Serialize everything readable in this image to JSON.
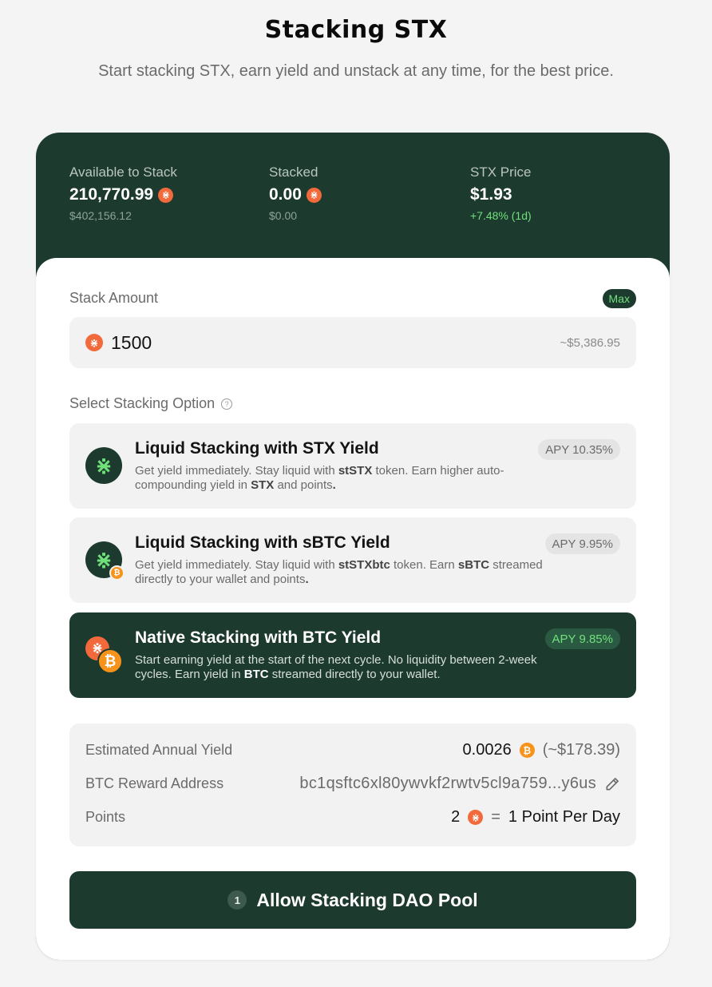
{
  "header": {
    "title": "Stacking STX",
    "subtitle": "Start stacking STX, earn yield and unstack at any time, for the best price."
  },
  "stats": {
    "available": {
      "label": "Available to Stack",
      "value": "210,770.99",
      "usd": "$402,156.12"
    },
    "stacked": {
      "label": "Stacked",
      "value": "0.00",
      "usd": "$0.00"
    },
    "price": {
      "label": "STX Price",
      "value": "$1.93",
      "change": "+7.48% (1d)"
    }
  },
  "form": {
    "amount_label": "Stack Amount",
    "max_label": "Max",
    "amount_value": "1500",
    "amount_usd": "~$5,386.95",
    "options_label": "Select Stacking Option"
  },
  "options": [
    {
      "title": "Liquid Stacking with STX Yield",
      "apy": "APY 10.35%",
      "desc": [
        "Get yield immediately. Stay liquid with ",
        "stSTX",
        " token. Earn higher auto-compounding yield in ",
        "STX",
        " and points",
        "."
      ],
      "selected": false
    },
    {
      "title": "Liquid Stacking with sBTC Yield",
      "apy": "APY 9.95%",
      "desc": [
        "Get yield immediately. Stay liquid with ",
        "stSTXbtc",
        " token. Earn ",
        "sBTC",
        " streamed directly to your wallet and points",
        "."
      ],
      "selected": false
    },
    {
      "title": "Native Stacking with BTC Yield",
      "apy": "APY 9.85%",
      "desc": [
        "Start earning yield at the start of the next cycle. No liquidity between 2-week cycles. Earn yield in ",
        "BTC",
        " streamed directly to your wallet."
      ],
      "selected": true
    }
  ],
  "summary": {
    "annual_yield_label": "Estimated Annual Yield",
    "annual_yield_value": "0.0026",
    "annual_yield_usd": "(~$178.39)",
    "address_label": "BTC Reward Address",
    "address_value": "bc1qsftc6xl80ywvkf2rwtv5cl9a759...y6us",
    "points_label": "Points",
    "points_value": "2",
    "points_equals": "=",
    "points_rate": "1 Point Per Day"
  },
  "cta": {
    "step": "1",
    "label": "Allow Stacking DAO Pool"
  },
  "icons": {
    "stx_glyph": "⋇",
    "btc_glyph": "₿",
    "help_glyph": "?"
  },
  "colors": {
    "brand_dark": "#1d3a2f",
    "accent_green": "#6fe07a",
    "stx_orange": "#f26a3c",
    "btc_orange": "#f7931a"
  }
}
